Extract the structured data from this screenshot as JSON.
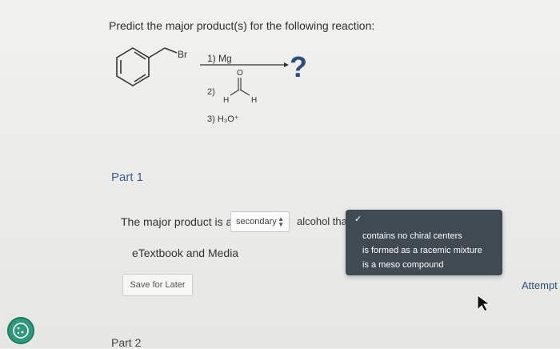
{
  "question": {
    "text": "Predict the major product(s) for the following reaction:"
  },
  "reaction": {
    "reagent_label": "Br",
    "step1": "1) Mg",
    "step2": "2)",
    "carbonyl_o": "O",
    "carbonyl_h_left": "H",
    "carbonyl_h_right": "H",
    "step3": "3) H₃O⁺",
    "unknown": "?"
  },
  "part1": {
    "label": "Part 1"
  },
  "answer": {
    "prefix": "The major product is a",
    "selected": "secondary",
    "suffix": "alcohol tha"
  },
  "dropdown": {
    "options": [
      "contains no chiral centers",
      "is formed as a racemic mixture",
      "is a meso compound"
    ]
  },
  "etextbook": "eTextbook and Media",
  "save_button": "Save for Later",
  "attempts": "Attempt",
  "part2": {
    "label": "Part 2"
  },
  "colors": {
    "accent": "#3a5f8f",
    "dropdown_bg": "#3f4a53",
    "question_mark": "#2b4f7d"
  }
}
